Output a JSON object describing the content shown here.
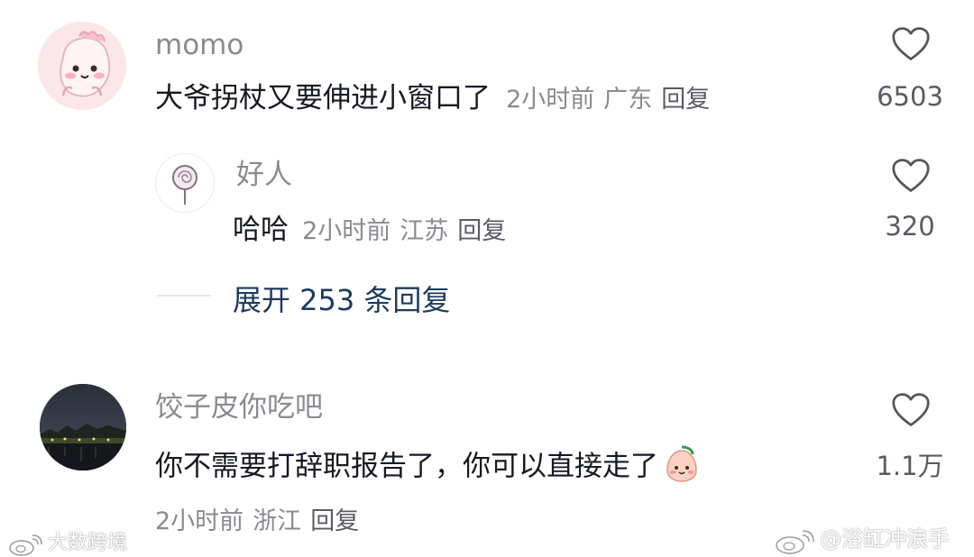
{
  "comments": [
    {
      "username": "momo",
      "text": "大爷拐杖又要伸进小窗口了",
      "time": "2小时前",
      "location": "广东",
      "reply_label": "回复",
      "likes": "6503",
      "icon": "heart-outline-icon"
    },
    {
      "username": "好人",
      "text": "哈哈",
      "time": "2小时前",
      "location": "江苏",
      "reply_label": "回复",
      "likes": "320",
      "icon": "heart-outline-icon"
    },
    {
      "username": "饺子皮你吃吧",
      "text": "你不需要打辞职报告了，你可以直接走了",
      "time": "2小时前",
      "location": "浙江",
      "reply_label": "回复",
      "likes": "1.1万",
      "icon": "heart-outline-icon"
    }
  ],
  "expand_replies": "展开 253 条回复",
  "watermarks": {
    "left": "大数跨境",
    "right": "@浴缸冲浪手"
  },
  "colors": {
    "username": "#8a8b91",
    "text": "#161823",
    "expand": "#1f3a5c"
  }
}
